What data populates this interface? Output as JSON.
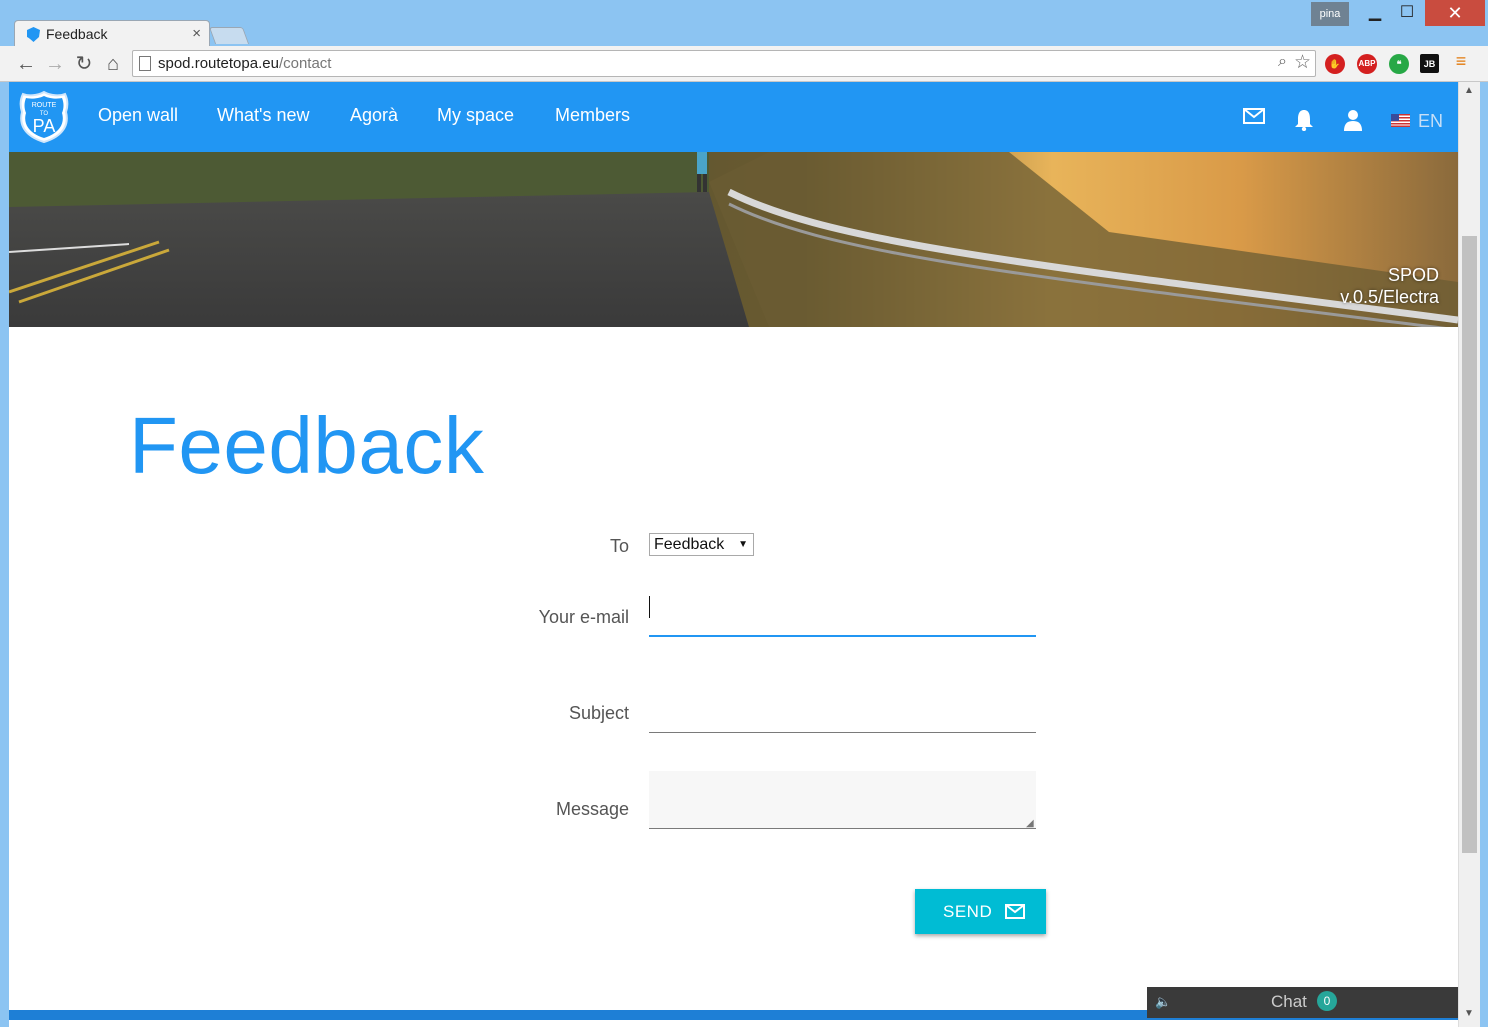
{
  "browser": {
    "tab_title": "Feedback",
    "tab_close": "×",
    "profile": "pina",
    "url_host": "spod.routetopa.eu",
    "url_path": "/contact",
    "ext_labels": [
      "",
      "ABP",
      "",
      "JB"
    ]
  },
  "site": {
    "logo_text_top": "ROUTE",
    "logo_text_mid": "TO",
    "logo_text_main": "PA",
    "nav": [
      "Open wall",
      "What's new",
      "Agorà",
      "My space",
      "Members"
    ],
    "lang": "EN",
    "brand_color": "#2196f3",
    "version_name": "SPOD",
    "version_number": "v.0.5/Electra"
  },
  "form": {
    "title": "Feedback",
    "to_label": "To",
    "to_value": "Feedback",
    "email_label": "Your e-mail",
    "email_value": "",
    "subject_label": "Subject",
    "subject_value": "",
    "message_label": "Message",
    "message_value": "",
    "send_label": "SEND",
    "send_color": "#00bcd4"
  },
  "chat": {
    "label": "Chat",
    "count": "0"
  }
}
